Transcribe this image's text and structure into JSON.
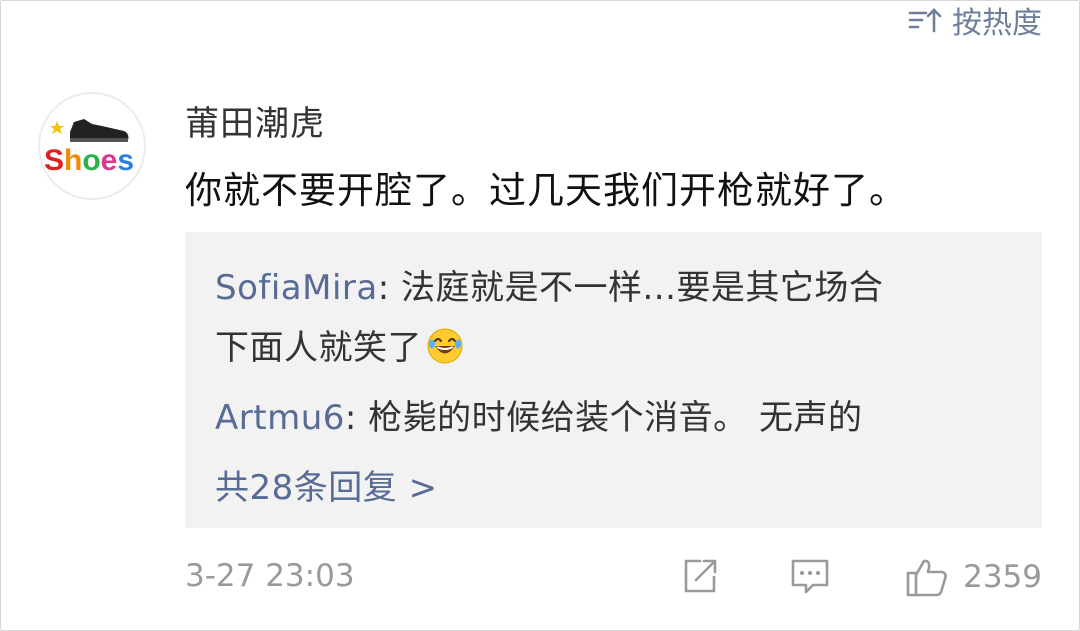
{
  "header": {
    "sort_label": "按热度",
    "sort_icon": "sort-icon"
  },
  "comment": {
    "avatar_text": "Shoes",
    "username": "莆田潮虎",
    "text": "你就不要开腔了。过几天我们开枪就好了。",
    "replies": [
      {
        "user": "SofiaMira",
        "separator": ": ",
        "text_line1": "法庭就是不一样...要是其它场合",
        "text_line2": "下面人就笑了",
        "emoji": "laugh-cry-emoji"
      },
      {
        "user": "Artmu6",
        "separator": ": ",
        "text_line1": "枪毙的时候给装个消音。 无声的"
      }
    ],
    "more_replies_label": "共28条回复 >",
    "timestamp": "3-27 23:03",
    "like_count": "2359"
  },
  "colors": {
    "link": "#576b95",
    "meta": "#9a9a9a",
    "reply_bg": "#f2f2f2"
  }
}
